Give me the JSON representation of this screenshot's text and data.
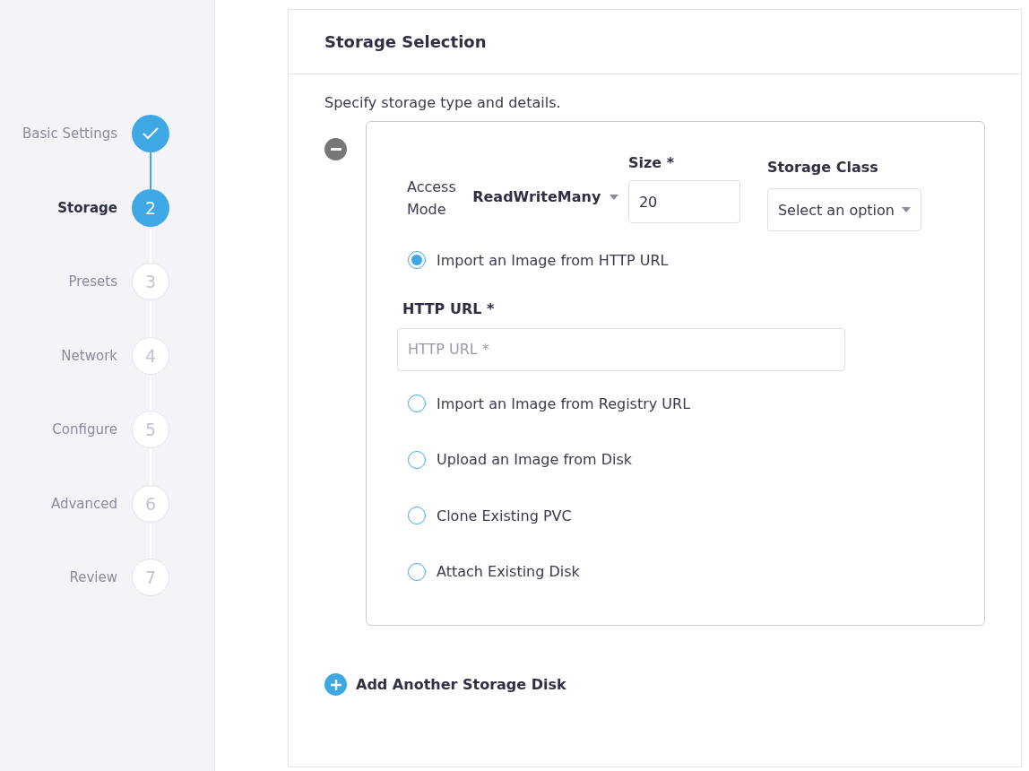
{
  "steps": [
    {
      "label": "Basic Settings",
      "completed": true,
      "selected": false
    },
    {
      "label": "Storage",
      "number": "2",
      "completed": false,
      "selected": true
    },
    {
      "label": "Presets",
      "number": "3",
      "completed": false,
      "selected": false
    },
    {
      "label": "Network",
      "number": "4",
      "completed": false,
      "selected": false
    },
    {
      "label": "Configure",
      "number": "5",
      "completed": false,
      "selected": false
    },
    {
      "label": "Advanced",
      "number": "6",
      "completed": false,
      "selected": false
    },
    {
      "label": "Review",
      "number": "7",
      "completed": false,
      "selected": false
    }
  ],
  "panel": {
    "title": "Storage Selection",
    "description": "Specify storage type and details.",
    "disk": {
      "access_mode": {
        "label": "Access Mode",
        "value": "ReadWriteMany"
      },
      "size": {
        "label": "Size *",
        "value": "20"
      },
      "storage_class": {
        "label": "Storage Class",
        "placeholder": "Select an option"
      },
      "sources": [
        {
          "label": "Import an Image from HTTP URL",
          "selected": true,
          "field": {
            "label": "HTTP URL *",
            "placeholder": "HTTP URL *"
          }
        },
        {
          "label": "Import an Image from Registry URL",
          "selected": false
        },
        {
          "label": "Upload an Image from Disk",
          "selected": false
        },
        {
          "label": "Clone Existing PVC",
          "selected": false
        },
        {
          "label": "Attach Existing Disk",
          "selected": false
        }
      ]
    },
    "add_button": "Add Another Storage Disk"
  }
}
